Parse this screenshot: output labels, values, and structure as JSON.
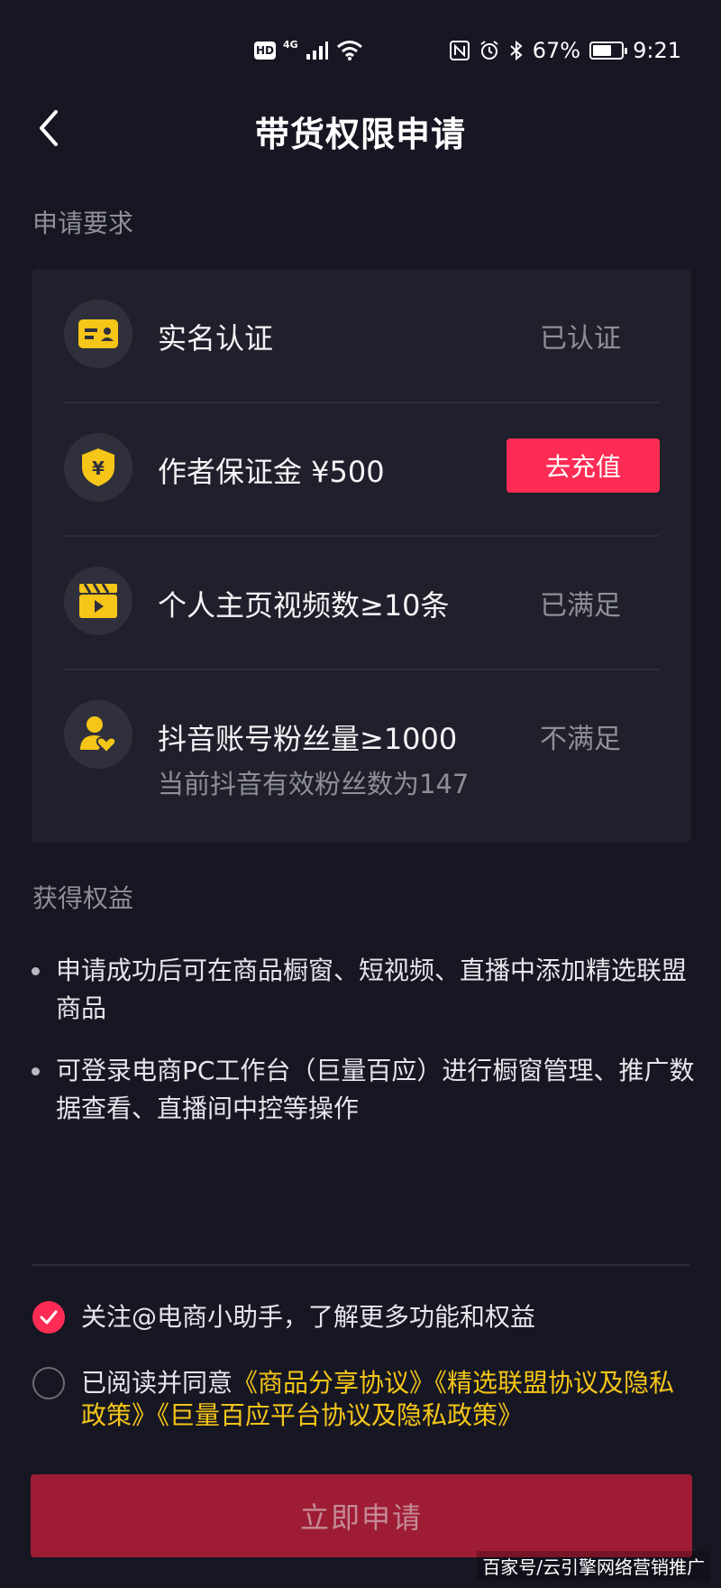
{
  "status_bar": {
    "hd": "HD",
    "network": "4G",
    "battery": "67%",
    "battery_level": 0.67,
    "time": "9:21"
  },
  "header": {
    "title": "带货权限申请"
  },
  "requirements": {
    "section_label": "申请要求",
    "items": [
      {
        "icon": "id-card-icon",
        "title": "实名认证",
        "status": "已认证"
      },
      {
        "icon": "yuan-shield-icon",
        "title": "作者保证金 ¥500",
        "action": "去充值"
      },
      {
        "icon": "video-clapper-icon",
        "title": "个人主页视频数≥10条",
        "status": "已满足"
      },
      {
        "icon": "fans-heart-icon",
        "title": "抖音账号粉丝量≥1000",
        "status": "不满足",
        "sub": "当前抖音有效粉丝数为147"
      }
    ]
  },
  "benefits": {
    "section_label": "获得权益",
    "items": [
      "申请成功后可在商品橱窗、短视频、直播中添加精选联盟商品",
      "可登录电商PC工作台（巨量百应）进行橱窗管理、推广数据查看、直播间中控等操作"
    ]
  },
  "agreements": {
    "follow_text": "关注@电商小助手，了解更多功能和权益",
    "follow_checked": true,
    "agree_prefix": "已阅读并同意",
    "agree_links": [
      "《商品分享协议》",
      "《精选联盟协议及隐私政策》",
      "《巨量百应平台协议及隐私政策》"
    ],
    "agree_checked": false
  },
  "apply_button": "立即申请",
  "watermark": "百家号/云引擎网络营销推广",
  "colors": {
    "background": "#161723",
    "card": "#1f202b",
    "accent_red": "#fe2c55",
    "icon_yellow": "#f5c518",
    "link_yellow": "#f5c518",
    "apply_disabled": "#9e1d35"
  }
}
